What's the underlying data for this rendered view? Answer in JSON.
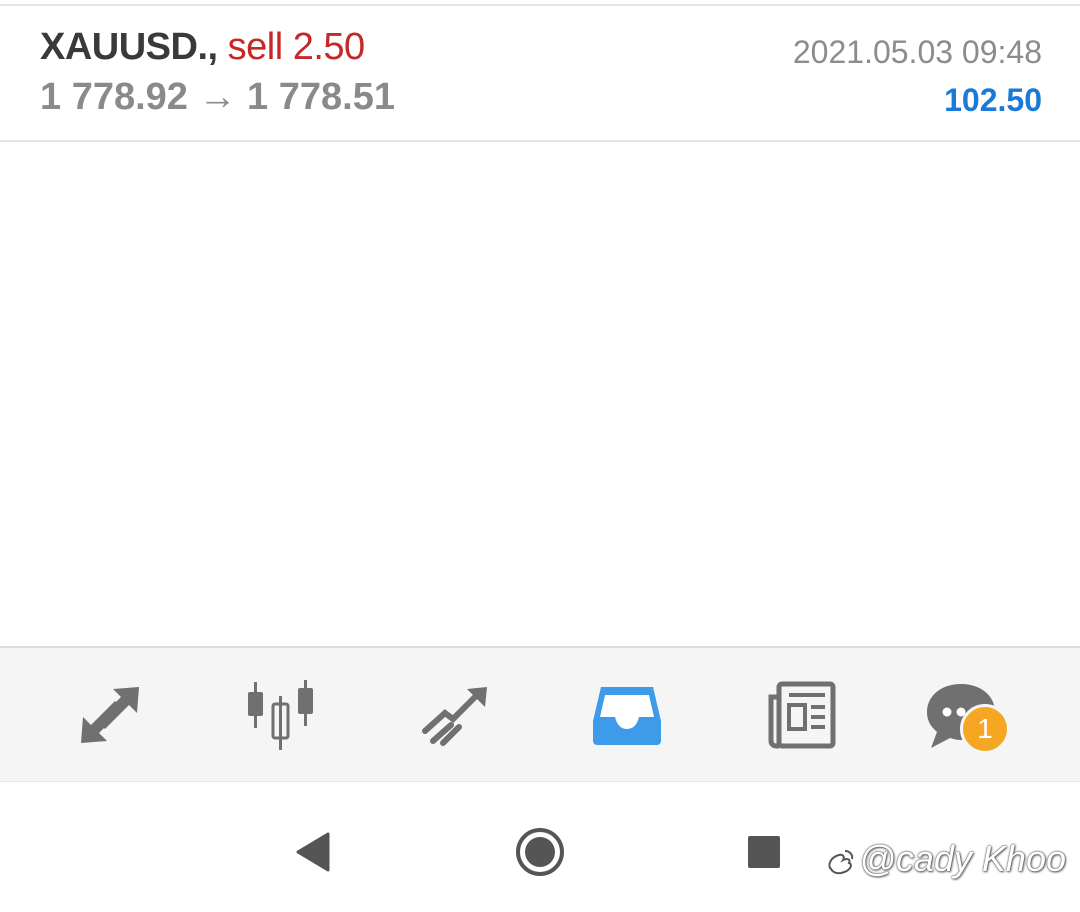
{
  "trade": {
    "symbol": "XAUUSD.,",
    "side_volume": "sell 2.50",
    "open_price": "1 778.92",
    "arrow": "→",
    "close_price": "1 778.51",
    "time": "2021.05.03 09:48",
    "profit": "102.50"
  },
  "tabbar": {
    "items": [
      {
        "name": "quotes-icon",
        "active": false
      },
      {
        "name": "chart-icon",
        "active": false
      },
      {
        "name": "trade-icon",
        "active": false
      },
      {
        "name": "history-icon",
        "active": true
      },
      {
        "name": "news-icon",
        "active": false
      },
      {
        "name": "messages-icon",
        "active": false
      }
    ],
    "messages_badge": "1"
  },
  "system_nav": {
    "back": "back-icon",
    "home": "home-icon",
    "recents": "recents-icon"
  },
  "watermark": {
    "text": "@cady Khoo"
  },
  "colors": {
    "sell": "#c62828",
    "profit": "#1a7ad9",
    "active_tab": "#3d9be9",
    "inactive_icon": "#707070",
    "badge": "#f5a623"
  }
}
